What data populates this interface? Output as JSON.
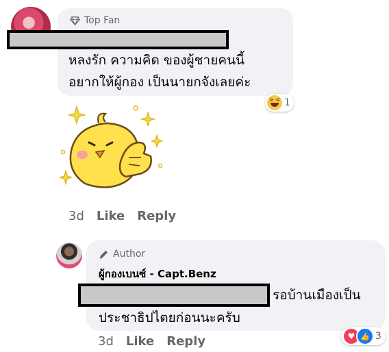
{
  "comment1": {
    "badge": "Top Fan",
    "lines": [
      "หลงรัก ความคิด ของผู้ชายคนนี้",
      "อยากให้ผู้กอง เป็นนายกจังเลยค่ะ"
    ],
    "reaction_icon": "laughing-emoji",
    "reaction_count": "1",
    "time": "3d",
    "like_label": "Like",
    "reply_label": "Reply"
  },
  "reply": {
    "badge": "Author",
    "author": "ผู้กองเบนซ์ - Capt.Benz",
    "line1_suffix": "รอบ้านเมืองเป็น",
    "line2": "ประชาธิปไตยก่อนนะครับ",
    "reaction_icons": [
      "heart-icon",
      "like-icon"
    ],
    "reaction_count": "3",
    "time": "3d",
    "like_label": "Like",
    "reply_label": "Reply"
  }
}
